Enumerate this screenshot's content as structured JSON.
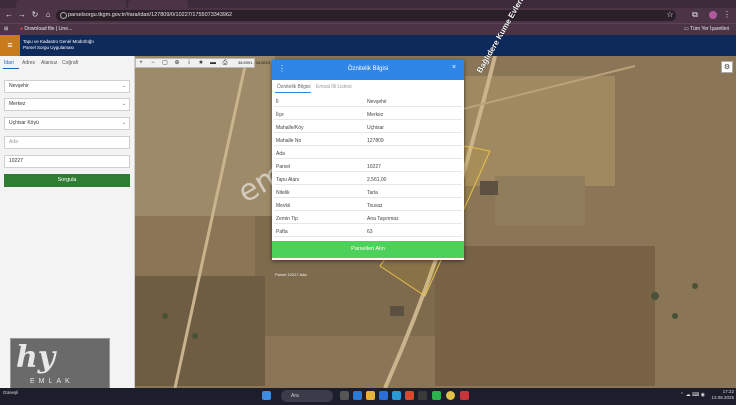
{
  "browser": {
    "tabs": [
      "",
      ""
    ],
    "url": "parselsorgu.tkgm.gov.tr/#ara/idari/127809/0/10227/1755073343962",
    "bookmarks": {
      "left": "Download file | Line...",
      "right": "Tüm Yer İşaretleri"
    }
  },
  "app": {
    "title_line1": "Tapu ve Kadastro Genel Müdürlüğü",
    "title_line2": "Parsel Sorgu Uygulaması"
  },
  "sidebar": {
    "tabs": [
      "İdari",
      "Adres",
      "Alansız",
      "Coğrafi"
    ],
    "province": "Nevşehir",
    "district": "Merkez",
    "neighborhood": "Uçhisar Köyü",
    "block_placeholder": "Ada",
    "parcel_value": "10227",
    "query_button": "Sorgula"
  },
  "map": {
    "coords": "38.6991 : 34.8023",
    "road_label": "Bağlıdere Kume Evleri",
    "parcel_tag": "Parsel 10227 Ada"
  },
  "modal": {
    "title": "Öznitelik Bilgisi",
    "tabs": [
      "Öznitelik Bilgisi",
      "Emsal İlli Listesi"
    ],
    "rows": [
      {
        "key": "İl",
        "value": "Nevşehir"
      },
      {
        "key": "İlçe",
        "value": "Merkez"
      },
      {
        "key": "Mahalle/Köy",
        "value": "Uçhisar"
      },
      {
        "key": "Mahalle No",
        "value": "127809"
      },
      {
        "key": "Ada",
        "value": ""
      },
      {
        "key": "Parsel",
        "value": "10227"
      },
      {
        "key": "Tapu Alanı",
        "value": "2.561,00"
      },
      {
        "key": "Nitelik",
        "value": "Tarla"
      },
      {
        "key": "Mevkii",
        "value": "Tsuvaz"
      },
      {
        "key": "Zemin Tip",
        "value": "Ana Taşınmaz"
      },
      {
        "key": "Pafta",
        "value": "63"
      }
    ],
    "detail_button": "Parselleri Alın"
  },
  "watermark": {
    "text": "emlakjet.com.tr",
    "logo_main": "hy",
    "logo_sub": "EMLAK"
  },
  "taskbar": {
    "weather": "Güneşli",
    "search": "Ara",
    "time": "17:22",
    "date": "13.08.2025"
  }
}
